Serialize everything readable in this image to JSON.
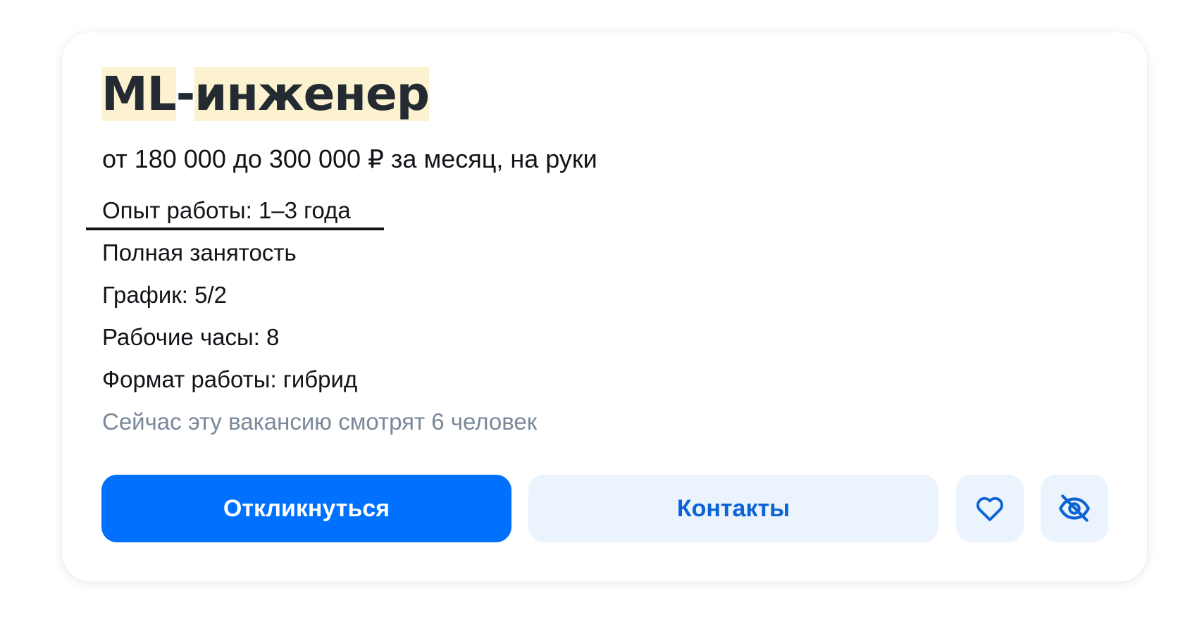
{
  "vacancy": {
    "title_part1": "ML",
    "title_sep": "-",
    "title_part2": "инженер",
    "salary": "от 180 000 до 300 000 ₽ за месяц, на руки",
    "details": {
      "experience": "Опыт работы: 1–3 года",
      "employment": "Полная занятость",
      "schedule": "График: 5/2",
      "hours": "Рабочие часы: 8",
      "format": "Формат работы: гибрид"
    },
    "viewers": "Сейчас эту вакансию смотрят 6 человек"
  },
  "actions": {
    "apply_label": "Откликнуться",
    "contacts_label": "Контакты",
    "favorite_icon": "heart-icon",
    "hide_icon": "eye-off-icon"
  },
  "colors": {
    "primary": "#0070ff",
    "secondary_bg": "#ebf3fd",
    "secondary_text": "#0b63d6",
    "highlight": "#fdf2cf",
    "muted_text": "#7a8899"
  }
}
